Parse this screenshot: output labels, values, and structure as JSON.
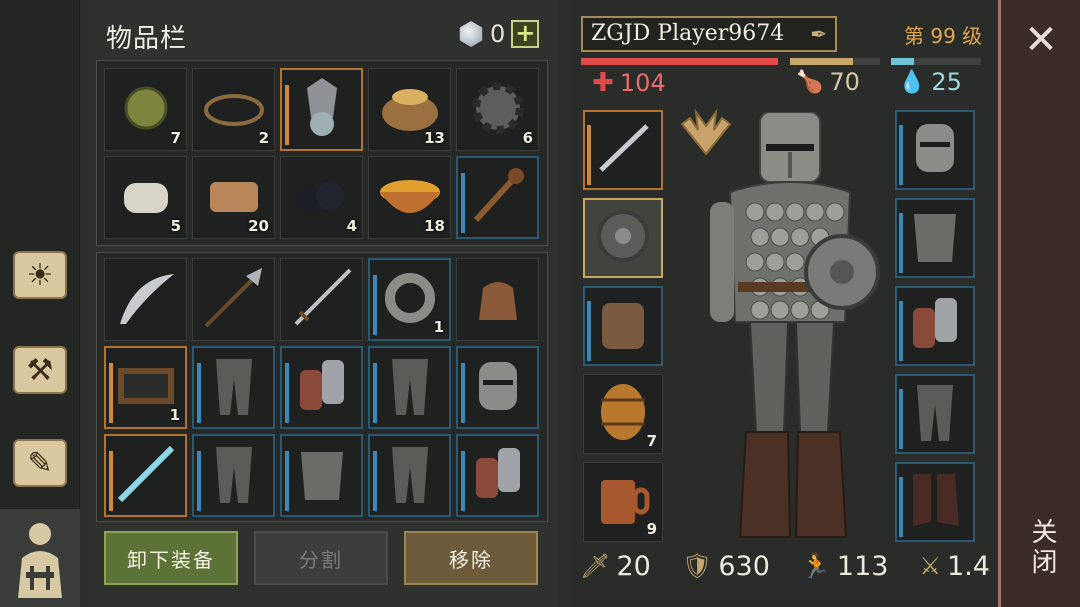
{
  "inventory": {
    "title": "物品栏",
    "currency": {
      "icon": "gem-icon",
      "count": "0",
      "add_label": "+"
    },
    "top_slots": [
      {
        "name": "plant-fiber-ball",
        "icon": "fiber-bundle-icon",
        "qty": "7",
        "border": "none"
      },
      {
        "name": "bear-trap",
        "icon": "trap-icon",
        "qty": "2",
        "border": "none"
      },
      {
        "name": "winged-helmet-figure",
        "icon": "helmet-figure-icon",
        "qty": "",
        "border": "orange"
      },
      {
        "name": "grain-sack",
        "icon": "sack-icon",
        "qty": "13",
        "border": "none"
      },
      {
        "name": "gear",
        "icon": "gear-icon",
        "qty": "6",
        "border": "none"
      },
      {
        "name": "cloth-roll",
        "icon": "cloth-roll-icon",
        "qty": "5",
        "border": "none"
      },
      {
        "name": "leather",
        "icon": "leather-icon",
        "qty": "20",
        "border": "none"
      },
      {
        "name": "coal",
        "icon": "coal-icon",
        "qty": "4",
        "border": "none"
      },
      {
        "name": "soup-bowl",
        "icon": "soup-icon",
        "qty": "18",
        "border": "none"
      },
      {
        "name": "spiked-club",
        "icon": "club-icon",
        "qty": "",
        "border": "blue"
      }
    ],
    "bottom_slots": [
      {
        "name": "scimitar",
        "icon": "scimitar-icon",
        "qty": "",
        "border": "none"
      },
      {
        "name": "halberd",
        "icon": "halberd-icon",
        "qty": "",
        "border": "none"
      },
      {
        "name": "longsword",
        "icon": "sword-icon",
        "qty": "",
        "border": "none"
      },
      {
        "name": "iron-ring",
        "icon": "ring-icon",
        "qty": "1",
        "border": "blue"
      },
      {
        "name": "leather-bag",
        "icon": "bag-icon",
        "qty": "",
        "border": "none"
      },
      {
        "name": "wooden-frame",
        "icon": "frame-icon",
        "qty": "1",
        "border": "orange"
      },
      {
        "name": "chain-leggings-1",
        "icon": "leggings-icon",
        "qty": "",
        "border": "blue"
      },
      {
        "name": "gauntlets-1",
        "icon": "gauntlet-icon",
        "qty": "",
        "border": "blue"
      },
      {
        "name": "chain-leggings-2",
        "icon": "leggings-icon",
        "qty": "",
        "border": "blue"
      },
      {
        "name": "great-helm",
        "icon": "helmet-icon",
        "qty": "",
        "border": "blue"
      },
      {
        "name": "ice-sword",
        "icon": "ice-sword-icon",
        "qty": "",
        "border": "orange"
      },
      {
        "name": "chain-leggings-3",
        "icon": "leggings-icon",
        "qty": "",
        "border": "blue"
      },
      {
        "name": "scale-armor",
        "icon": "armor-icon",
        "qty": "",
        "border": "blue"
      },
      {
        "name": "chain-leggings-4",
        "icon": "leggings-icon",
        "qty": "",
        "border": "blue"
      },
      {
        "name": "gauntlets-2",
        "icon": "gauntlet-icon",
        "qty": "",
        "border": "blue"
      }
    ],
    "buttons": {
      "unequip": "卸下装备",
      "split": "分割",
      "remove": "移除"
    }
  },
  "character": {
    "name": "ZGJD Player9674",
    "level": "第 99 级",
    "health": {
      "value": "104",
      "percent": 100,
      "color": "#e14a4a"
    },
    "food": {
      "value": "70",
      "percent": 70,
      "color": "#c9a86c"
    },
    "water": {
      "value": "25",
      "percent": 25,
      "color": "#6ec3d4"
    },
    "left_equipment": [
      {
        "name": "dagger",
        "icon": "dagger-icon",
        "qty": "",
        "border": "orange"
      },
      {
        "name": "round-shield",
        "icon": "shield-icon",
        "qty": "",
        "border": "gold"
      },
      {
        "name": "backpack",
        "icon": "backpack-icon",
        "qty": "",
        "border": "blue"
      },
      {
        "name": "barrel",
        "icon": "barrel-icon",
        "qty": "7",
        "border": "none"
      },
      {
        "name": "tankard",
        "icon": "tankard-icon",
        "qty": "9",
        "border": "none"
      }
    ],
    "right_equipment": [
      {
        "name": "helmet",
        "icon": "helmet-icon",
        "qty": "",
        "border": "blue"
      },
      {
        "name": "chest",
        "icon": "armor-icon",
        "qty": "",
        "border": "blue"
      },
      {
        "name": "gloves",
        "icon": "gauntlet-icon",
        "qty": "",
        "border": "blue"
      },
      {
        "name": "legs",
        "icon": "leggings-icon",
        "qty": "",
        "border": "blue"
      },
      {
        "name": "boots",
        "icon": "boots-icon",
        "qty": "",
        "border": "blue"
      }
    ],
    "stats": {
      "attack": "20",
      "defense": "630",
      "speed": "113",
      "multiplier": "1.4"
    }
  },
  "sidebar": [
    "journal-icon",
    "craft-hammer-icon",
    "scroll-quill-icon",
    "character-icon"
  ],
  "close": {
    "label": "关闭"
  }
}
